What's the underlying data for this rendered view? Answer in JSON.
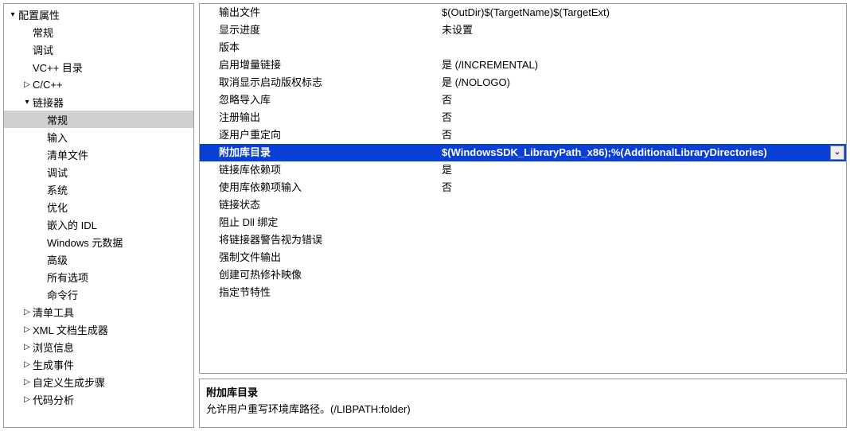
{
  "tree": [
    {
      "label": "配置属性",
      "indent": 0,
      "arrow": "down",
      "selected": false
    },
    {
      "label": "常规",
      "indent": 1,
      "arrow": "none",
      "selected": false
    },
    {
      "label": "调试",
      "indent": 1,
      "arrow": "none",
      "selected": false
    },
    {
      "label": "VC++ 目录",
      "indent": 1,
      "arrow": "none",
      "selected": false
    },
    {
      "label": "C/C++",
      "indent": 1,
      "arrow": "right",
      "selected": false
    },
    {
      "label": "链接器",
      "indent": 1,
      "arrow": "down",
      "selected": false
    },
    {
      "label": "常规",
      "indent": 2,
      "arrow": "none",
      "selected": true
    },
    {
      "label": "输入",
      "indent": 2,
      "arrow": "none",
      "selected": false
    },
    {
      "label": "清单文件",
      "indent": 2,
      "arrow": "none",
      "selected": false
    },
    {
      "label": "调试",
      "indent": 2,
      "arrow": "none",
      "selected": false
    },
    {
      "label": "系统",
      "indent": 2,
      "arrow": "none",
      "selected": false
    },
    {
      "label": "优化",
      "indent": 2,
      "arrow": "none",
      "selected": false
    },
    {
      "label": "嵌入的 IDL",
      "indent": 2,
      "arrow": "none",
      "selected": false
    },
    {
      "label": "Windows 元数据",
      "indent": 2,
      "arrow": "none",
      "selected": false
    },
    {
      "label": "高级",
      "indent": 2,
      "arrow": "none",
      "selected": false
    },
    {
      "label": "所有选项",
      "indent": 2,
      "arrow": "none",
      "selected": false
    },
    {
      "label": "命令行",
      "indent": 2,
      "arrow": "none",
      "selected": false
    },
    {
      "label": "清单工具",
      "indent": 1,
      "arrow": "right",
      "selected": false
    },
    {
      "label": "XML 文档生成器",
      "indent": 1,
      "arrow": "right",
      "selected": false
    },
    {
      "label": "浏览信息",
      "indent": 1,
      "arrow": "right",
      "selected": false
    },
    {
      "label": "生成事件",
      "indent": 1,
      "arrow": "right",
      "selected": false
    },
    {
      "label": "自定义生成步骤",
      "indent": 1,
      "arrow": "right",
      "selected": false
    },
    {
      "label": "代码分析",
      "indent": 1,
      "arrow": "right",
      "selected": false
    }
  ],
  "grid": [
    {
      "label": "输出文件",
      "value": "$(OutDir)$(TargetName)$(TargetExt)",
      "selected": false
    },
    {
      "label": "显示进度",
      "value": "未设置",
      "selected": false
    },
    {
      "label": "版本",
      "value": "",
      "selected": false
    },
    {
      "label": "启用增量链接",
      "value": "是 (/INCREMENTAL)",
      "selected": false
    },
    {
      "label": "取消显示启动版权标志",
      "value": "是 (/NOLOGO)",
      "selected": false
    },
    {
      "label": "忽略导入库",
      "value": "否",
      "selected": false
    },
    {
      "label": "注册输出",
      "value": "否",
      "selected": false
    },
    {
      "label": "逐用户重定向",
      "value": "否",
      "selected": false
    },
    {
      "label": "附加库目录",
      "value": "$(WindowsSDK_LibraryPath_x86);%(AdditionalLibraryDirectories)",
      "selected": true
    },
    {
      "label": "链接库依赖项",
      "value": "是",
      "selected": false
    },
    {
      "label": "使用库依赖项输入",
      "value": "否",
      "selected": false
    },
    {
      "label": "链接状态",
      "value": "",
      "selected": false
    },
    {
      "label": "阻止 Dll 绑定",
      "value": "",
      "selected": false
    },
    {
      "label": "将链接器警告视为错误",
      "value": "",
      "selected": false
    },
    {
      "label": "强制文件输出",
      "value": "",
      "selected": false
    },
    {
      "label": "创建可热修补映像",
      "value": "",
      "selected": false
    },
    {
      "label": "指定节特性",
      "value": "",
      "selected": false
    }
  ],
  "desc": {
    "title": "附加库目录",
    "text": "允许用户重写环境库路径。(/LIBPATH:folder)"
  },
  "glyphs": {
    "arrow_down": "▾",
    "arrow_right": "▷",
    "dropdown": "⌄"
  }
}
